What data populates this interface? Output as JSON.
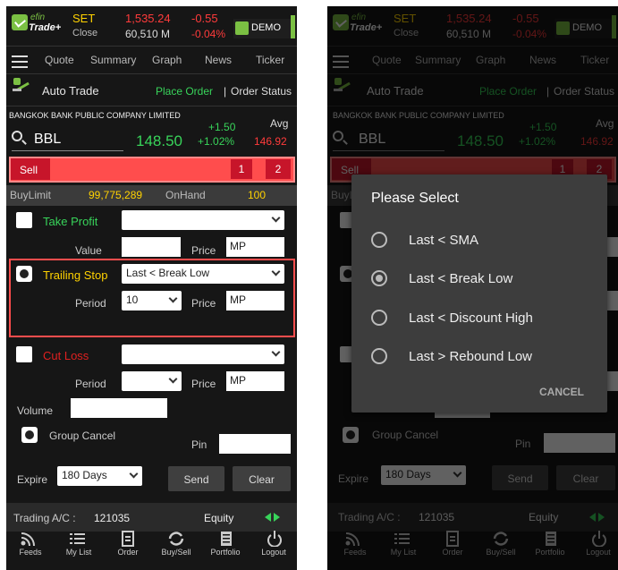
{
  "header": {
    "logo_top": "efin",
    "logo_bottom": "Trade+",
    "market": "SET",
    "market_sub": "Close",
    "index_value": "1,535.24",
    "volume": "60,510 M",
    "change": "-0.55",
    "change_pct": "-0.04%",
    "demo_label": "DEMO"
  },
  "tabs": [
    "Quote",
    "Summary",
    "Graph",
    "News",
    "Ticker"
  ],
  "autotrade": {
    "title": "Auto Trade",
    "place_order": "Place Order",
    "separator": "|",
    "order_status": "Order Status"
  },
  "stock": {
    "company": "BANGKOK BANK PUBLIC COMPANY LIMITED",
    "symbol": "BBL",
    "price": "148.50",
    "change": "+1.50",
    "change_pct": "+1.02%",
    "avg_label": "Avg",
    "avg": "146.92"
  },
  "order": {
    "side": "Sell",
    "count1": "1",
    "count2": "2",
    "buy_limit_label": "BuyLimit",
    "buy_limit": "99,775,289",
    "on_hand_label": "OnHand",
    "on_hand": "100"
  },
  "take_profit": {
    "label": "Take Profit",
    "value_label": "Value",
    "price_label": "Price",
    "price": "MP"
  },
  "trailing_stop": {
    "label": "Trailing Stop",
    "condition": "Last < Break Low",
    "period_label": "Period",
    "period": "10",
    "price_label": "Price",
    "price": "MP"
  },
  "cut_loss": {
    "label": "Cut Loss",
    "period_label": "Period",
    "price_label": "Price",
    "price": "MP"
  },
  "volume_label": "Volume",
  "group_cancel": "Group Cancel",
  "pin_label": "Pin",
  "expire_label": "Expire",
  "expire_value": "180 Days",
  "send": "Send",
  "clear": "Clear",
  "trading": {
    "label": "Trading A/C :",
    "account": "121035",
    "type": "Equity"
  },
  "footer": [
    "Feeds",
    "My List",
    "Order",
    "Buy/Sell",
    "Portfolio",
    "Logout"
  ],
  "dialog": {
    "title": "Please Select",
    "options": [
      "Last < SMA",
      "Last < Break Low",
      "Last < Discount High",
      "Last > Rebound Low"
    ],
    "selected_index": 1,
    "cancel": "CANCEL"
  },
  "colors": {
    "green": "#38d45a",
    "red": "#ff4d4d",
    "yellow": "#ffd200",
    "background": "#161616"
  }
}
